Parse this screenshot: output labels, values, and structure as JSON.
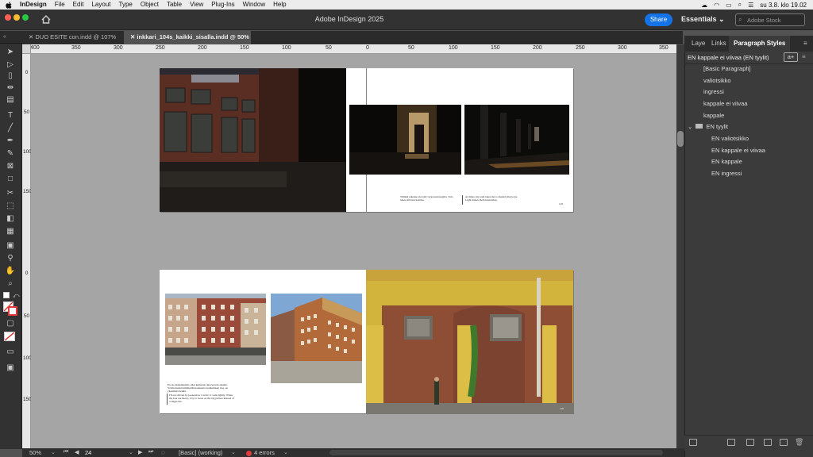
{
  "menubar": {
    "app_name": "InDesign",
    "items": [
      "File",
      "Edit",
      "Layout",
      "Type",
      "Object",
      "Table",
      "View",
      "Plug-Ins",
      "Window",
      "Help"
    ],
    "clock": "su 3.8. klo 19.02"
  },
  "appbar": {
    "title": "Adobe InDesign 2025",
    "share_label": "Share",
    "workspace_label": "Essentials",
    "search_placeholder": "Adobe Stock"
  },
  "tabs": [
    {
      "label": "DUO ESITE con.indd @ 107%",
      "active": false
    },
    {
      "label": "inkkari_104s_kaikki_sisalla.indd @ 50%",
      "active": true
    }
  ],
  "ruler": {
    "h_labels": [
      "400",
      "350",
      "300",
      "250",
      "200",
      "150",
      "100",
      "50",
      "0",
      "50",
      "100",
      "150",
      "200",
      "250",
      "300",
      "350"
    ],
    "v_labels": [
      "0",
      "50",
      "100",
      "150",
      "0",
      "50",
      "100",
      "150"
    ]
  },
  "spread1": {
    "caption_left": "Tiiliskä rakenne vieroitti varjossaan kujalla. Valo tekee siitä kuvaustilaa.",
    "caption_right": "At times, my path takes me to shaded alleyways. Light makes them interesting.",
    "page_number": "119"
  },
  "spread2": {
    "caption_left": "En ole maksimalisti, siksi kuljetaan aina kevein askelin. Yritän mennä kimmeltää kauneutta, kulkemisen iloa, en yksittäisiä hetkiä.",
    "caption_right": "I'm not driven by possession. I strive to walk lightly. When my feet are heavy, I try to focus on the big picture instead of a single tile.",
    "page_number": "120"
  },
  "status": {
    "zoom": "50%",
    "page": "24",
    "style": "[Basic] (working)",
    "errors": "4 errors"
  },
  "panel": {
    "tabs": [
      "Laye",
      "Links",
      "Paragraph Styles"
    ],
    "current_style": "EN kappale ei viivaa (EN tyylit)",
    "styles": [
      "[Basic Paragraph]",
      "valiotsikko",
      "ingressi",
      "kappale ei viivaa",
      "kappale"
    ],
    "group_name": "EN tyylit",
    "group_styles": [
      "EN valiotsikko",
      "EN kappale ei viivaa",
      "EN kappale",
      "EN ingressi"
    ]
  },
  "colors": {
    "accent": "#1473e6",
    "canvas": "#a5a5a5",
    "error": "#e03a3a"
  }
}
